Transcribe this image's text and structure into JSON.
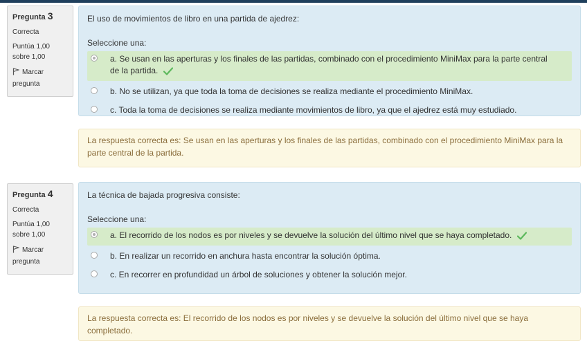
{
  "questions": [
    {
      "label": "Pregunta",
      "number": "3",
      "state": "Correcta",
      "grade": "Puntúa 1,00 sobre 1,00",
      "flag_label": "Marcar pregunta",
      "text": "El uso de movimientos de libro en una partida de ajedrez:",
      "prompt": "Seleccione una:",
      "answers": [
        "a. Se usan en las aperturas y los finales de las partidas, combinado con el procedimiento MiniMax para la parte central de la partida.",
        "b. No se utilizan, ya que toda la toma de decisiones se realiza mediante el procedimiento MiniMax.",
        "c. Toda la toma de decisiones se realiza mediante movimientos de libro, ya que el ajedrez está muy estudiado."
      ],
      "selected_index": 0,
      "feedback": "La respuesta correcta es: Se usan en las aperturas y los finales de las partidas, combinado con el procedimiento MiniMax para la parte central de la partida."
    },
    {
      "label": "Pregunta",
      "number": "4",
      "state": "Correcta",
      "grade": "Puntúa 1,00 sobre 1,00",
      "flag_label": "Marcar pregunta",
      "text": "La técnica de bajada progresiva consiste:",
      "prompt": "Seleccione una:",
      "answers": [
        "a. El recorrido de los nodos es por niveles y se devuelve la solución del último nivel que se haya completado.",
        "b. En realizar un recorrido en anchura hasta encontrar la solución óptima.",
        "c. En recorrer en profundidad un árbol de soluciones y obtener la solución mejor."
      ],
      "selected_index": 0,
      "feedback": "La respuesta correcta es: El recorrido de los nodos es por niveles y se devuelve la solución del último nivel que se haya completado."
    }
  ],
  "colors": {
    "content_bg": "#dcebf4",
    "correct_bg": "#d6ebc9",
    "feedback_bg": "#fcf8e3",
    "feedback_text": "#8a6d3b",
    "check": "#5cb85c"
  },
  "icons": {
    "flag": "flag-icon",
    "correct": "check-icon"
  }
}
